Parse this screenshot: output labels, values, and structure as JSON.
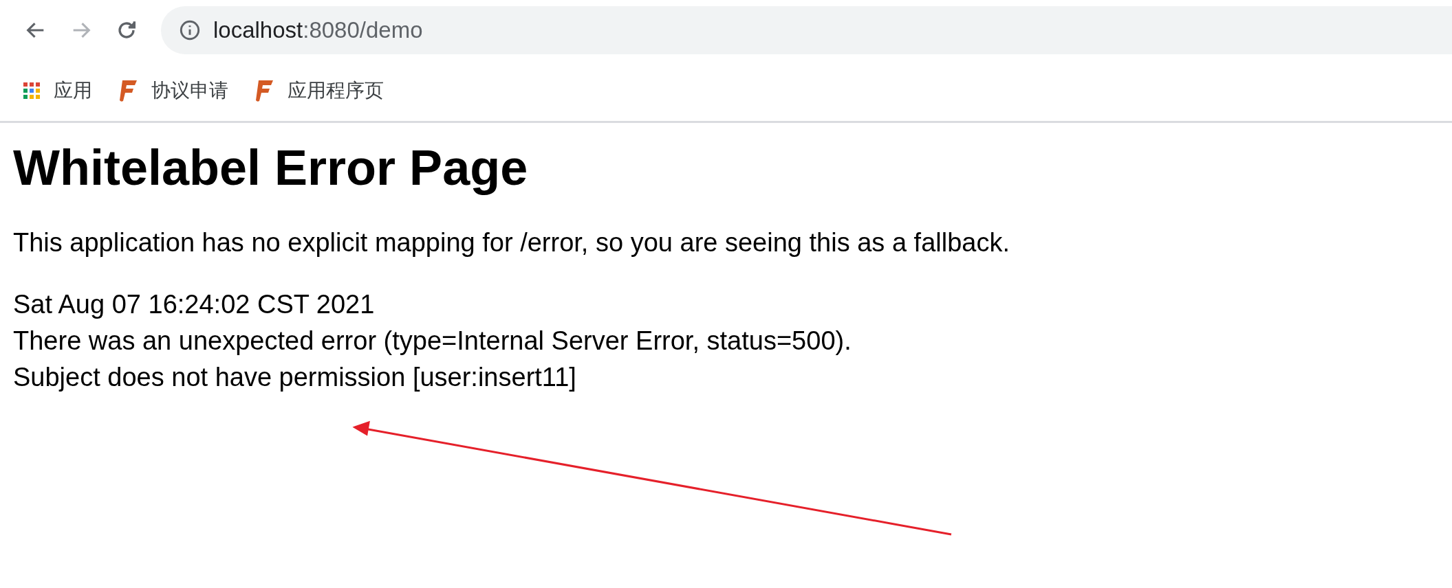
{
  "toolbar": {
    "back": {
      "disabled": false
    },
    "forward": {
      "disabled": true
    },
    "address": {
      "host": "localhost",
      "path": ":8080/demo"
    }
  },
  "bookmarks": [
    {
      "kind": "apps",
      "label": "应用"
    },
    {
      "kind": "site",
      "label": "协议申请"
    },
    {
      "kind": "site",
      "label": "应用程序页"
    }
  ],
  "page": {
    "heading": "Whitelabel Error Page",
    "intro": "This application has no explicit mapping for /error, so you are seeing this as a fallback.",
    "lines": [
      "Sat Aug 07 16:24:02 CST 2021",
      "There was an unexpected error (type=Internal Server Error, status=500).",
      "Subject does not have permission [user:insert11]"
    ]
  },
  "annotation": {
    "kind": "arrow"
  }
}
